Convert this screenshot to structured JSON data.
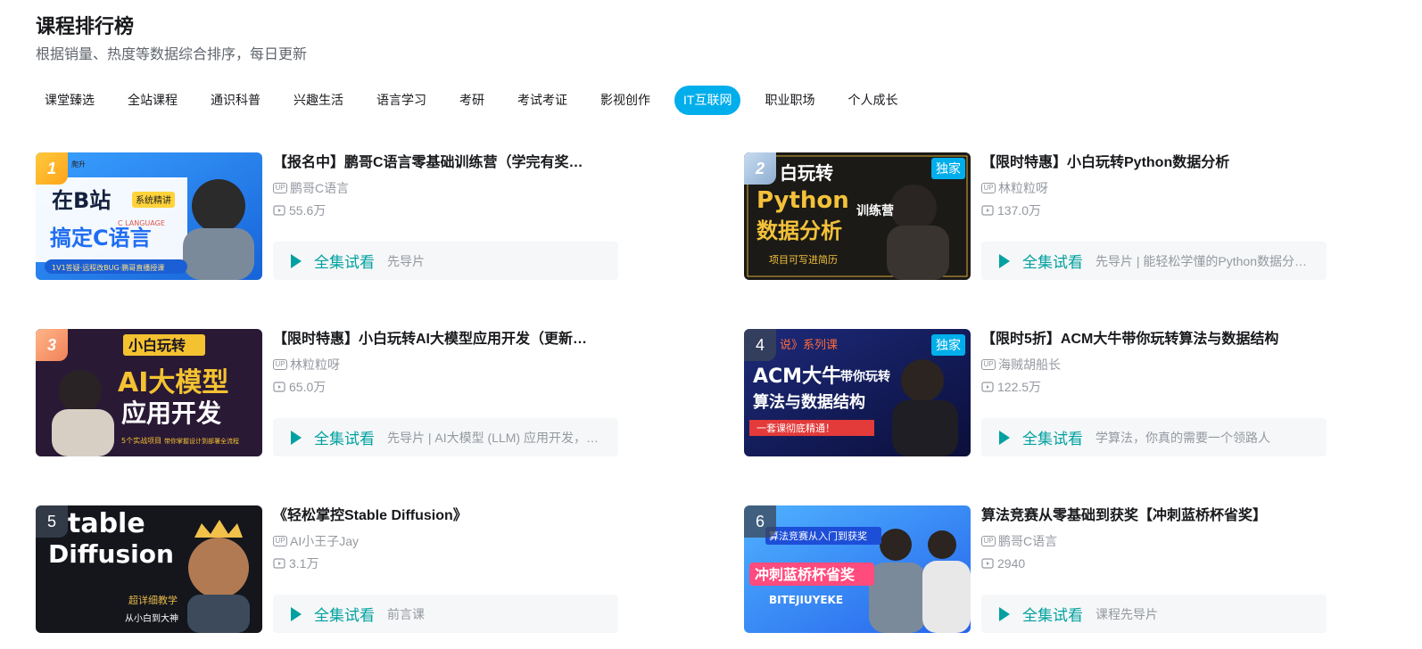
{
  "header": {
    "title": "课程排行榜",
    "subtitle": "根据销量、热度等数据综合排序，每日更新"
  },
  "tabs": [
    {
      "label": "课堂臻选",
      "active": false
    },
    {
      "label": "全站课程",
      "active": false
    },
    {
      "label": "通识科普",
      "active": false
    },
    {
      "label": "兴趣生活",
      "active": false
    },
    {
      "label": "语言学习",
      "active": false
    },
    {
      "label": "考研",
      "active": false
    },
    {
      "label": "考试考证",
      "active": false
    },
    {
      "label": "影视创作",
      "active": false
    },
    {
      "label": "IT互联网",
      "active": true
    },
    {
      "label": "职业职场",
      "active": false
    },
    {
      "label": "个人成长",
      "active": false
    }
  ],
  "colors": {
    "accent": "#00aeec",
    "trial_text": "#00a1a0",
    "meta_text": "#9499a0"
  },
  "courses": [
    {
      "rank": "1",
      "title": "【报名中】鹏哥C语言零基础训练营（学完有奖…",
      "author": "鹏哥C语言",
      "views": "55.6万",
      "trial_label": "全集试看",
      "trial_desc": "先导片",
      "exclusive": "",
      "thumb_text": [
        "在B站",
        "搞定C语言",
        "C LANGUAGE",
        "系统精讲",
        "1V1答疑·远程改BUG·鹏哥直播授课",
        "爬升"
      ]
    },
    {
      "rank": "2",
      "title": "【限时特惠】小白玩转Python数据分析",
      "author": "林粒粒呀",
      "views": "137.0万",
      "trial_label": "全集试看",
      "trial_desc": "先导片 | 能轻松学懂的Python数据分…",
      "exclusive": "独家",
      "thumb_text": [
        "白玩转",
        "Python",
        "数据分析",
        "训练营",
        "项目可写进简历"
      ]
    },
    {
      "rank": "3",
      "title": "【限时特惠】小白玩转AI大模型应用开发（更新…",
      "author": "林粒粒呀",
      "views": "65.0万",
      "trial_label": "全集试看",
      "trial_desc": "先导片 | AI大模型 (LLM) 应用开发，…",
      "exclusive": "",
      "thumb_text": [
        "小白玩转",
        "AI大模型",
        "应用开发",
        "5个实战项目",
        "带你掌握设计到部署全流程"
      ]
    },
    {
      "rank": "4",
      "title": "【限时5折】ACM大牛带你玩转算法与数据结构",
      "author": "海贼胡船长",
      "views": "122.5万",
      "trial_label": "全集试看",
      "trial_desc": "学算法，你真的需要一个领路人",
      "exclusive": "独家",
      "thumb_text": [
        "说》系列课",
        "ACM大牛",
        "带你玩转",
        "算法与数据结构",
        "一套课彻底精通！"
      ]
    },
    {
      "rank": "5",
      "title": "《轻松掌控Stable Diffusion》",
      "author": "AI小王子Jay",
      "views": "3.1万",
      "trial_label": "全集试看",
      "trial_desc": "前言课",
      "exclusive": "",
      "thumb_text": [
        "table",
        "Diffusion",
        "超详细教学",
        "从小白到大神"
      ]
    },
    {
      "rank": "6",
      "title": "算法竞赛从零基础到获奖【冲刺蓝桥杯省奖】",
      "author": "鹏哥C语言",
      "views": "2940",
      "trial_label": "全集试看",
      "trial_desc": "课程先导片",
      "exclusive": "",
      "thumb_text": [
        "算法竞赛从入门到获奖",
        "冲刺蓝桥杯省奖",
        "BITEJIUYEKE"
      ]
    }
  ]
}
